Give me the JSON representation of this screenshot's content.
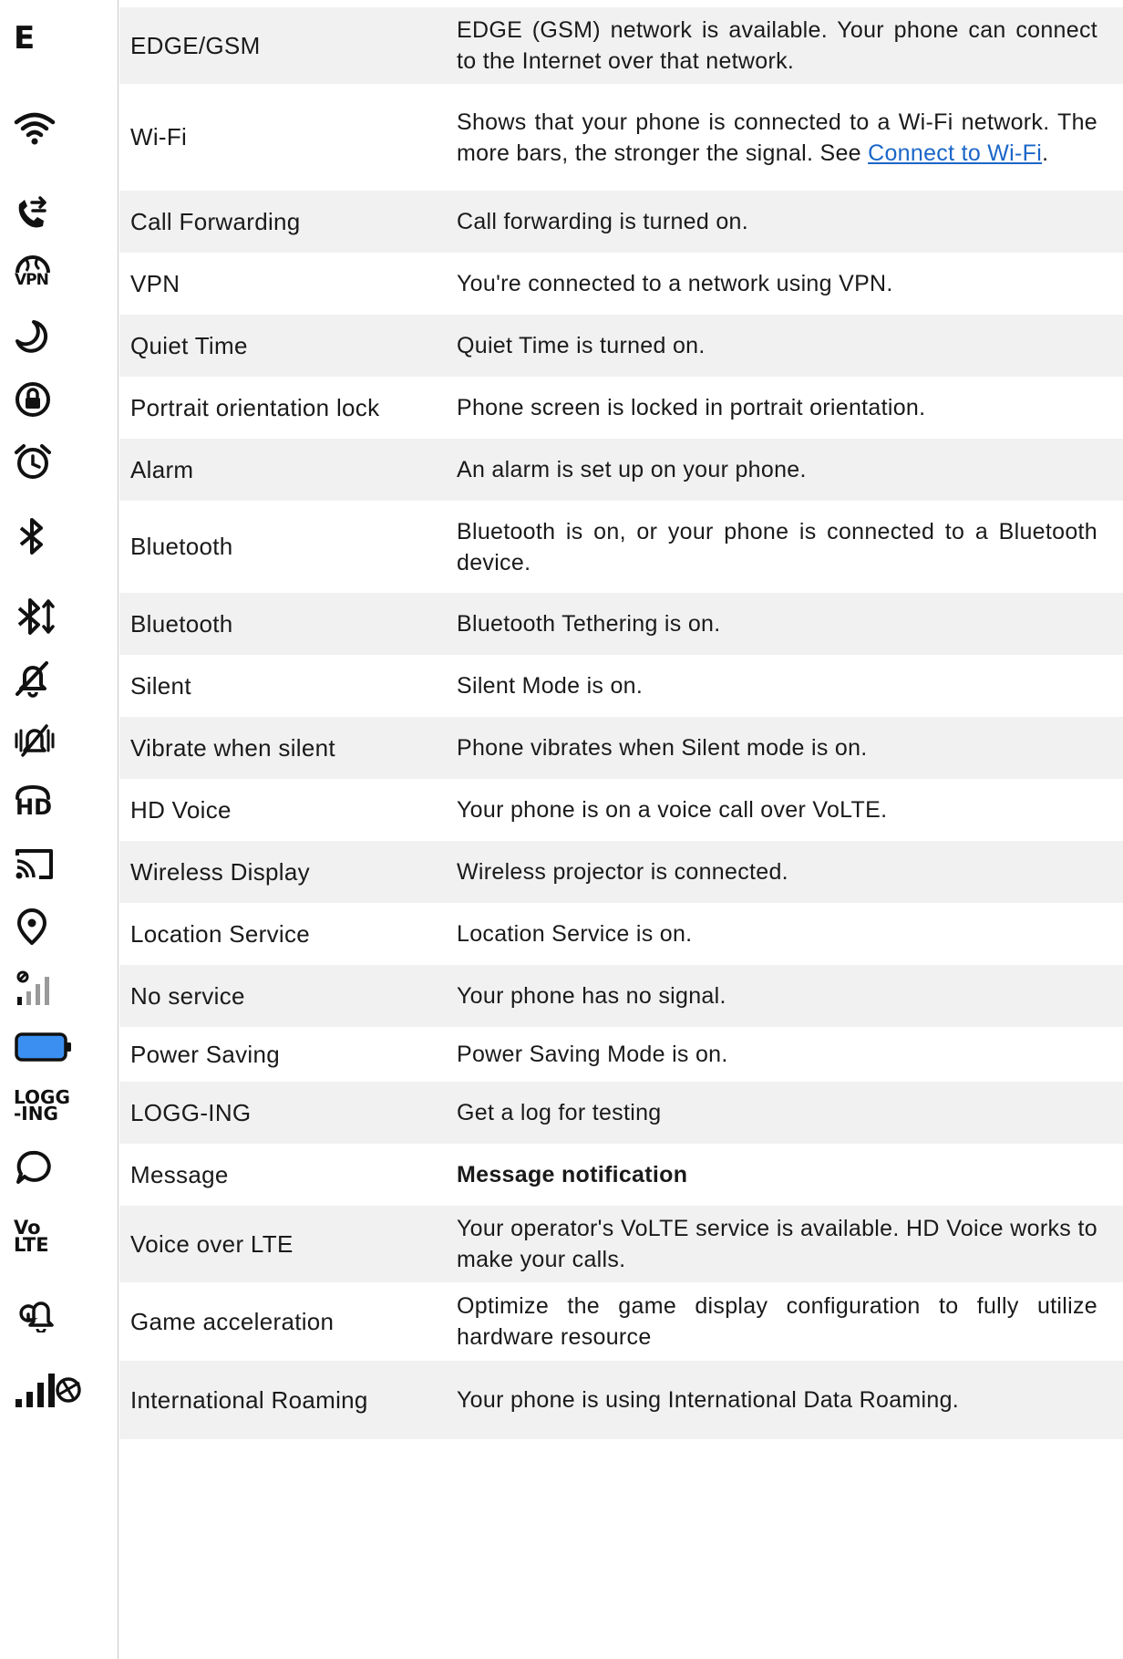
{
  "rows": [
    {
      "icon": "edge-icon",
      "glyph": "E",
      "name": "EDGE/GSM",
      "desc": "EDGE (GSM) network is available. Your phone can connect to the Internet over that network."
    },
    {
      "icon": "wifi-icon",
      "name": "Wi-Fi",
      "desc": "Shows that your phone is connected to a Wi-Fi network. The more bars, the stronger the signal. See ",
      "link": "Connect to Wi-Fi",
      "desc_after": "."
    },
    {
      "icon": "call-forwarding-icon",
      "name": "Call Forwarding",
      "desc": "Call forwarding is turned on."
    },
    {
      "icon": "vpn-icon",
      "glyph": "VPN",
      "name": "VPN",
      "desc": "You're connected to a network using VPN."
    },
    {
      "icon": "moon-icon",
      "name": "Quiet Time",
      "desc": "Quiet Time is turned on."
    },
    {
      "icon": "orientation-lock-icon",
      "name": "Portrait orientation lock",
      "desc": "Phone screen is locked in portrait orientation."
    },
    {
      "icon": "alarm-clock-icon",
      "name": "Alarm",
      "desc": "An alarm is set up on your phone."
    },
    {
      "icon": "bluetooth-icon",
      "name": "Bluetooth",
      "desc": "Bluetooth is on, or your phone is connected to a Bluetooth device."
    },
    {
      "icon": "bluetooth-tethering-icon",
      "name": "Bluetooth",
      "desc": "Bluetooth Tethering is on."
    },
    {
      "icon": "bell-off-icon",
      "name": "Silent",
      "desc": "Silent Mode is on."
    },
    {
      "icon": "vibrate-bell-off-icon",
      "name": "Vibrate when silent",
      "desc": "Phone vibrates when Silent mode is on."
    },
    {
      "icon": "hd-voice-icon",
      "glyph": "HD",
      "name": "HD Voice",
      "desc": "Your phone is on a voice call over VoLTE."
    },
    {
      "icon": "cast-icon",
      "name": "Wireless Display",
      "desc": "Wireless projector is connected."
    },
    {
      "icon": "location-pin-icon",
      "name": "Location Service",
      "desc": "Location Service is on."
    },
    {
      "icon": "no-signal-icon",
      "name": "No service",
      "desc": "Your phone has no signal."
    },
    {
      "icon": "battery-icon",
      "name": "Power Saving",
      "desc": "Power Saving Mode is on."
    },
    {
      "icon": "logging-icon",
      "glyph": "LOGG\n-ING",
      "name": "LOGG-ING",
      "desc": "Get a log for testing"
    },
    {
      "icon": "message-bubble-icon",
      "name": "Message",
      "desc": "Message notification"
    },
    {
      "icon": "volte-icon",
      "glyph": "Vo\nLTE",
      "name": "Voice over LTE",
      "desc": "Your operator's VoLTE service is available. HD Voice works to make your calls."
    },
    {
      "icon": "game-acceleration-icon",
      "name": "Game acceleration",
      "desc": "Optimize the game display configuration to fully utilize hardware resource"
    },
    {
      "icon": "roaming-signal-icon",
      "name": "International Roaming",
      "desc": "Your phone is using International Data Roaming."
    }
  ],
  "colors": {
    "battery_fill": "#3b8ff0",
    "link": "#1a66c8",
    "row_shade": "#f1f1f1",
    "dim_bars": "#9a9a9a"
  }
}
